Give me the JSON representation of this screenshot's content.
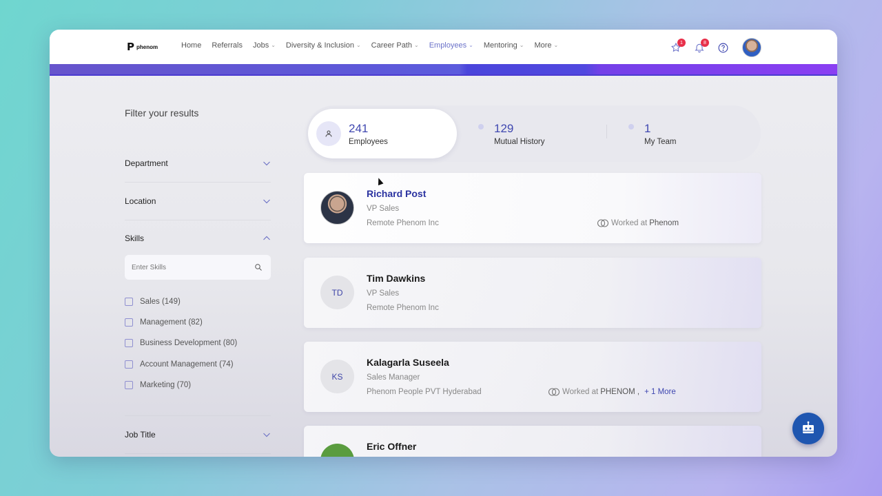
{
  "app": {
    "logo_mark": "P",
    "logo_text": "phenom"
  },
  "nav": {
    "items": [
      {
        "label": "Home",
        "dropdown": false
      },
      {
        "label": "Referrals",
        "dropdown": false
      },
      {
        "label": "Jobs",
        "dropdown": true
      },
      {
        "label": "Diversity & Inclusion",
        "dropdown": true
      },
      {
        "label": "Career Path",
        "dropdown": true
      },
      {
        "label": "Employees",
        "dropdown": true,
        "active": true
      },
      {
        "label": "Mentoring",
        "dropdown": true
      },
      {
        "label": "More",
        "dropdown": true
      }
    ],
    "chevron": "⌄",
    "saved_badge": "1",
    "notifications_badge": "8"
  },
  "colors": {
    "accent": "#3f47b0",
    "active_nav": "#6b72c9",
    "badge": "#e8304a",
    "chatbot": "#1f56b0"
  },
  "sidebar": {
    "title": "Filter your results",
    "sections": {
      "department": "Department",
      "location": "Location",
      "skills": "Skills",
      "job_title": "Job Title"
    },
    "skills_placeholder": "Enter Skills",
    "skills": [
      {
        "label": "Sales (149)",
        "checked": false
      },
      {
        "label": "Management (82)",
        "checked": false
      },
      {
        "label": "Business Development (80)",
        "checked": false
      },
      {
        "label": "Account Management (74)",
        "checked": false
      },
      {
        "label": "Marketing (70)",
        "checked": false
      }
    ]
  },
  "tabs": [
    {
      "count": "241",
      "label": "Employees",
      "active": true
    },
    {
      "count": "129",
      "label": "Mutual History",
      "active": false
    },
    {
      "count": "1",
      "label": "My Team",
      "active": false
    }
  ],
  "employees": [
    {
      "name": "Richard Post",
      "title": "VP Sales",
      "company": "Remote Phenom Inc",
      "initials": "",
      "worked_prefix": "Worked at",
      "worked_org": "Phenom",
      "more": ""
    },
    {
      "name": "Tim Dawkins",
      "title": "VP Sales",
      "company": "Remote Phenom Inc",
      "initials": "TD"
    },
    {
      "name": "Kalagarla Suseela",
      "title": "Sales Manager",
      "company": "Phenom People PVT Hyderabad",
      "initials": "KS",
      "worked_prefix": "Worked at",
      "worked_org": "PHENOM ,",
      "more": "+ 1 More"
    },
    {
      "name": "Eric Offner",
      "title": "",
      "company": "",
      "initials": ""
    }
  ]
}
